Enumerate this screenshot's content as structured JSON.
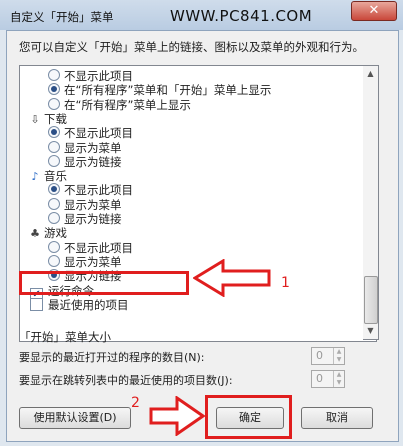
{
  "window": {
    "title": "自定义「开始」菜单",
    "watermark": "WWW.PC841.COM",
    "close_label": "✕"
  },
  "description": "您可以自定义「开始」菜单上的链接、图标以及菜单的外观和行为。",
  "list": {
    "rows": [
      {
        "kind": "radio",
        "label": "不显示此项目",
        "checked": false
      },
      {
        "kind": "radio",
        "label": "在“所有程序”菜单和「开始」菜单上显示",
        "checked": true
      },
      {
        "kind": "radio",
        "label": "在“所有程序”菜单上显示",
        "checked": false
      },
      {
        "kind": "category",
        "label": "下载",
        "icon": "download-folder-icon"
      },
      {
        "kind": "radio",
        "label": "不显示此项目",
        "checked": true
      },
      {
        "kind": "radio",
        "label": "显示为菜单",
        "checked": false
      },
      {
        "kind": "radio",
        "label": "显示为链接",
        "checked": false
      },
      {
        "kind": "category",
        "label": "音乐",
        "icon": "music-note-icon"
      },
      {
        "kind": "radio",
        "label": "不显示此项目",
        "checked": true
      },
      {
        "kind": "radio",
        "label": "显示为菜单",
        "checked": false
      },
      {
        "kind": "radio",
        "label": "显示为链接",
        "checked": false
      },
      {
        "kind": "category",
        "label": "游戏",
        "icon": "games-icon"
      },
      {
        "kind": "radio",
        "label": "不显示此项目",
        "checked": false
      },
      {
        "kind": "radio",
        "label": "显示为菜单",
        "checked": false
      },
      {
        "kind": "radio",
        "label": "显示为链接",
        "checked": true
      },
      {
        "kind": "checkbox",
        "label": "运行命令",
        "checked": true
      },
      {
        "kind": "checkbox",
        "label": "最近使用的项目",
        "checked": false
      }
    ]
  },
  "size_group": {
    "label": "「开始」菜单大小",
    "recent_programs_label": "要显示的最近打开过的程序的数目(N):",
    "recent_programs_value": "0",
    "jumplist_label": "要显示在跳转列表中的最近使用的项目数(J):",
    "jumplist_value": "0"
  },
  "buttons": {
    "defaults": "使用默认设置(D)",
    "ok": "确定",
    "cancel": "取消"
  },
  "annotations": {
    "step1": "1",
    "step2": "2"
  },
  "colors": {
    "highlight": "#e01e1e",
    "radio_dot": "#2b4f86"
  }
}
